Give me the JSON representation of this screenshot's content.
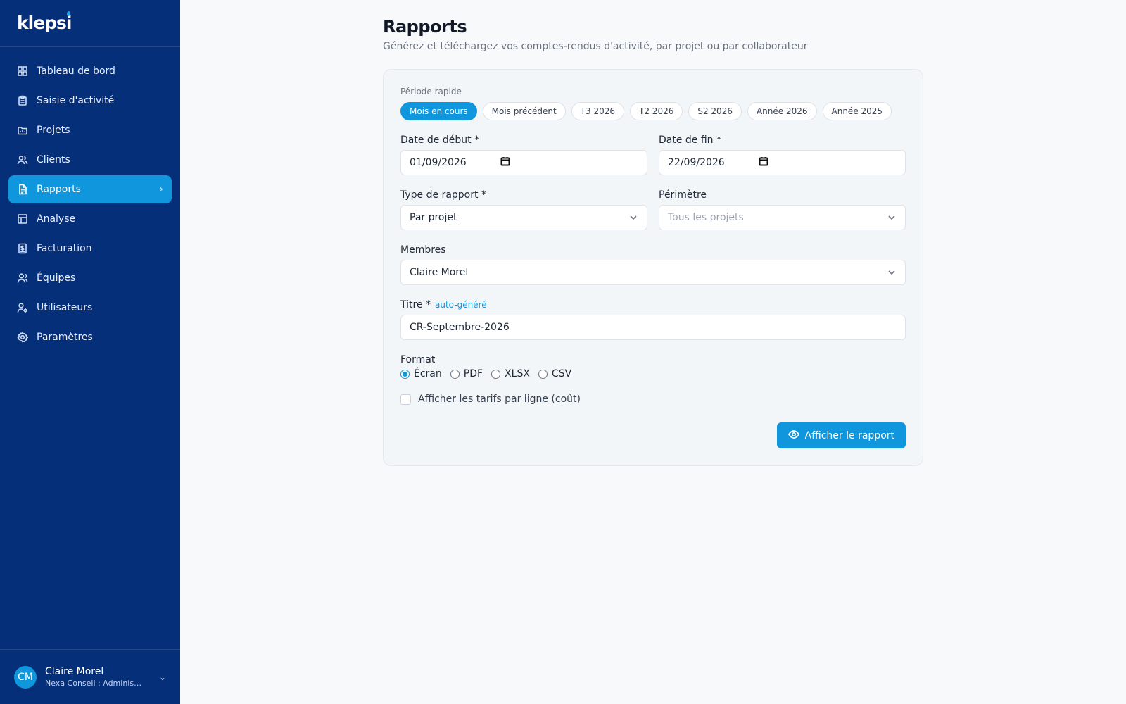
{
  "brand": {
    "logo_text": "klepsi",
    "accent": "#0f96dc",
    "sidebar_bg": "#062f7a"
  },
  "sidebar": {
    "items": [
      {
        "label": "Tableau de bord",
        "icon": "dashboard-icon"
      },
      {
        "label": "Saisie d'activité",
        "icon": "clipboard-icon"
      },
      {
        "label": "Projets",
        "icon": "folder-icon"
      },
      {
        "label": "Clients",
        "icon": "users-icon"
      },
      {
        "label": "Rapports",
        "icon": "report-icon",
        "active": true
      },
      {
        "label": "Analyse",
        "icon": "table-icon"
      },
      {
        "label": "Facturation",
        "icon": "invoice-icon"
      },
      {
        "label": "Équipes",
        "icon": "team-icon"
      },
      {
        "label": "Utilisateurs",
        "icon": "user-cog-icon"
      },
      {
        "label": "Paramètres",
        "icon": "gear-icon"
      }
    ],
    "user": {
      "initials": "CM",
      "name": "Claire Morel",
      "org": "Nexa Conseil : Administr…"
    }
  },
  "page": {
    "title": "Rapports",
    "subtitle": "Générez et téléchargez vos comptes-rendus d'activité, par projet ou par collaborateur"
  },
  "form": {
    "quick_period_label": "Période rapide",
    "quick_periods": [
      {
        "label": "Mois en cours",
        "active": true
      },
      {
        "label": "Mois précédent"
      },
      {
        "label": "T3 2026"
      },
      {
        "label": "T2 2026"
      },
      {
        "label": "S2 2026"
      },
      {
        "label": "Année 2026"
      },
      {
        "label": "Année 2025"
      }
    ],
    "start_date_label": "Date de début",
    "start_date_value": "01/09/2026",
    "end_date_label": "Date de fin",
    "end_date_value": "22/09/2026",
    "required_mark": "*",
    "report_type_label": "Type de rapport",
    "report_type_value": "Par projet",
    "scope_label": "Périmètre",
    "scope_placeholder": "Tous les projets",
    "members_label": "Membres",
    "members_value": "Claire Morel",
    "title_label": "Titre",
    "title_auto_tag": "auto-généré",
    "title_value": "CR-Septembre-2026",
    "format_label": "Format",
    "formats": [
      {
        "label": "Écran",
        "checked": true
      },
      {
        "label": "PDF"
      },
      {
        "label": "XLSX"
      },
      {
        "label": "CSV"
      }
    ],
    "show_rates_label": "Afficher les tarifs par ligne (coût)",
    "submit_label": "Afficher le rapport"
  }
}
